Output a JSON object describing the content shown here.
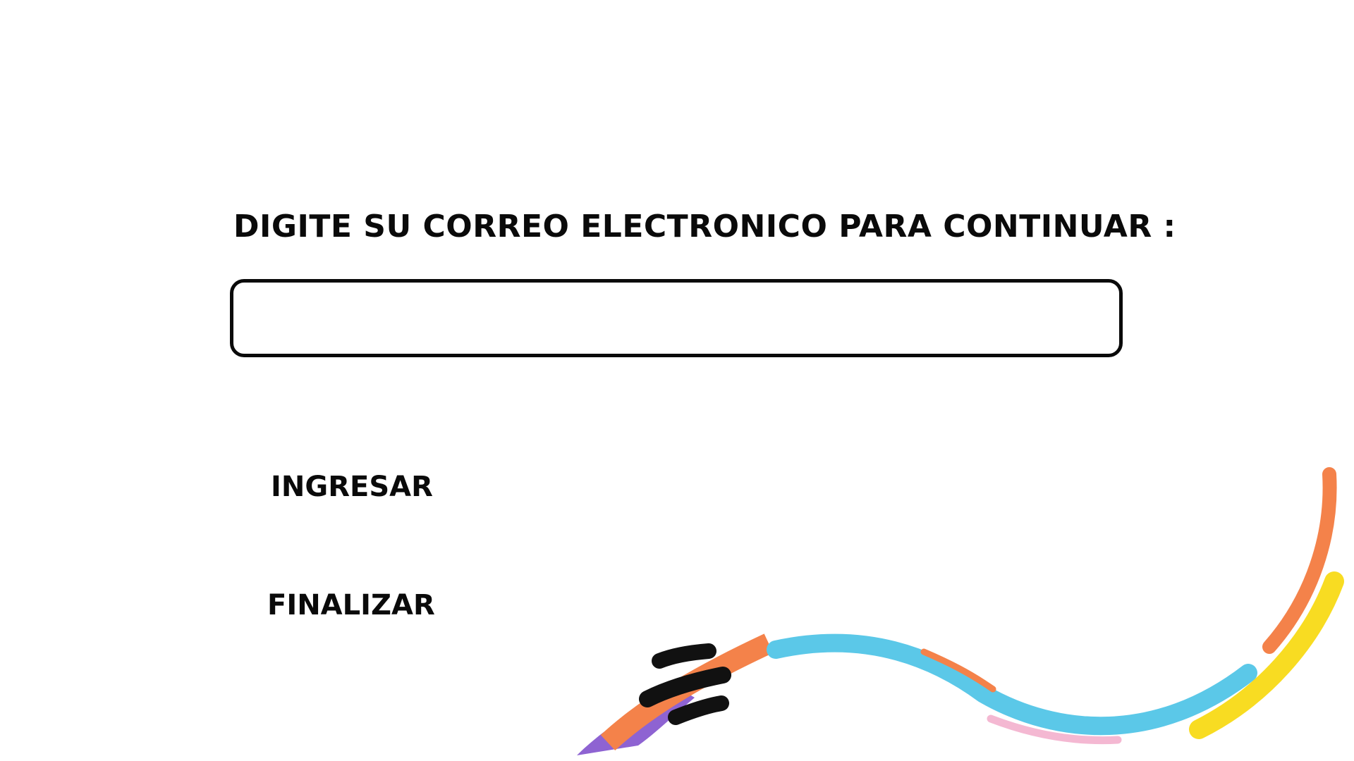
{
  "page": {
    "prompt": "DIGITE SU CORREO ELECTRONICO PARA CONTINUAR :"
  },
  "email_input": {
    "value": "",
    "placeholder": ""
  },
  "actions": {
    "ingresar_label": "INGRESAR",
    "finalizar_label": "FINALIZAR"
  },
  "colors": {
    "background": "#ffffff",
    "text": "#0a0a0a",
    "stroke_purple": "#8e63d2",
    "stroke_orange": "#f4824a",
    "stroke_blue": "#5bc8e8",
    "stroke_pink": "#f4b8d2",
    "stroke_yellow": "#f8dc22"
  }
}
